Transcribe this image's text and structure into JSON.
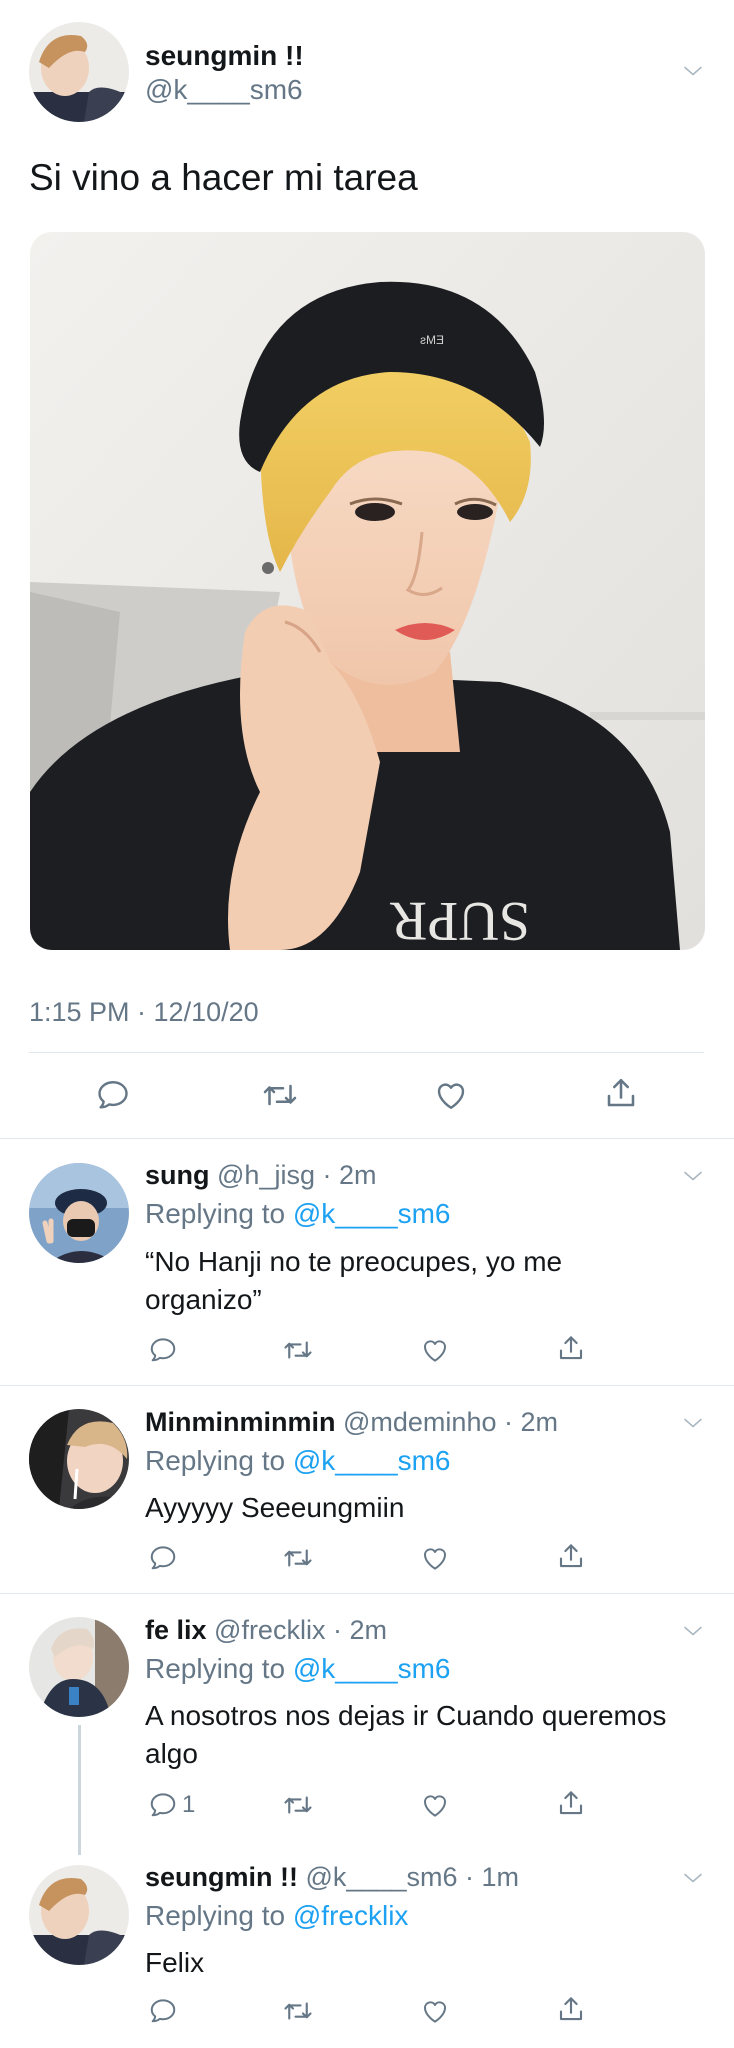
{
  "main_tweet": {
    "display_name": "seungmin !!",
    "handle": "@k____sm6",
    "text": "Si vino a hacer mi tarea",
    "timestamp": "1:15 PM · 12/10/20"
  },
  "replies": [
    {
      "display_name": "sung",
      "meta": " @h_jisg · 2m",
      "replying_prefix": "Replying to ",
      "replying_to": "@k____sm6",
      "text_line1": "“No Hanji no te preocupes, yo me",
      "text_line2": "organizo”"
    },
    {
      "display_name": "Minminminmin",
      "meta": " @mdeminho · 2m",
      "replying_prefix": "Replying to ",
      "replying_to": "@k____sm6",
      "text_line1": "Ayyyyy Seeeungmiin"
    },
    {
      "display_name": "fe lix",
      "meta": " @frecklix · 2m",
      "replying_prefix": "Replying to ",
      "replying_to": "@k____sm6",
      "text_line1": "A nosotros nos dejas ir Cuando queremos",
      "text_line2": "algo",
      "reply_count": "1"
    },
    {
      "display_name": "seungmin !!",
      "meta": " @k____sm6 · 1m",
      "replying_prefix": "Replying to ",
      "replying_to": "@frecklix",
      "text_line1": "Felix"
    }
  ],
  "icons": {
    "reply": "reply-icon",
    "retweet": "retweet-icon",
    "like": "heart-icon",
    "share": "share-icon",
    "more": "chevron-down-icon"
  },
  "colors": {
    "link": "#1da1f2",
    "secondary_text": "#657786",
    "divider": "#e1e8ed"
  }
}
